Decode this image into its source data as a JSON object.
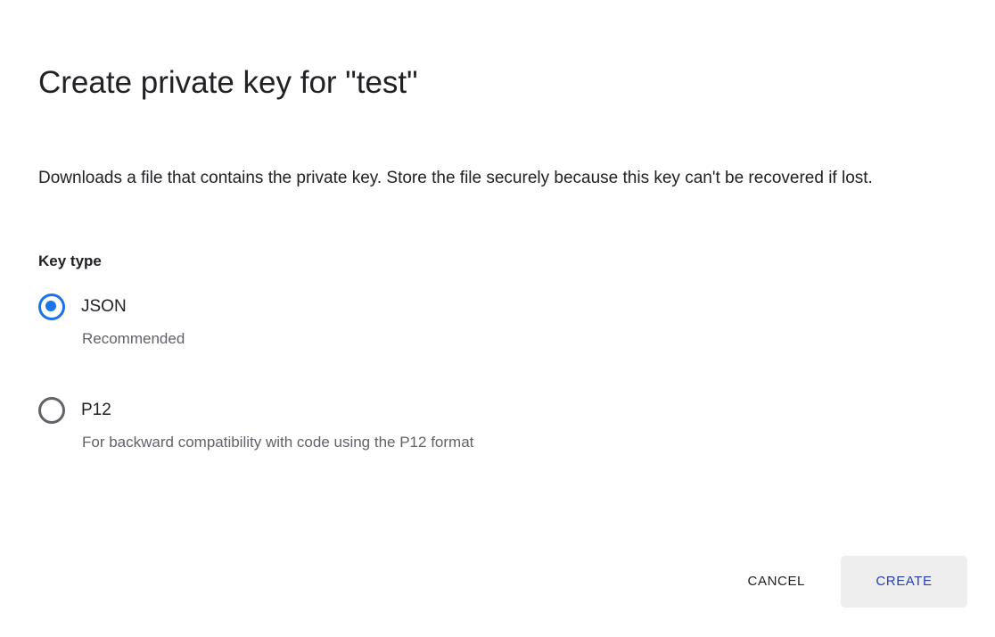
{
  "dialog": {
    "title": "Create private key for \"test\"",
    "description": "Downloads a file that contains the private key. Store the file securely because this key can't be recovered if lost.",
    "key_type": {
      "label": "Key type",
      "selected": "JSON",
      "options": [
        {
          "id": "json",
          "label": "JSON",
          "sublabel": "Recommended",
          "selected": true
        },
        {
          "id": "p12",
          "label": "P12",
          "sublabel": "For backward compatibility with code using the P12 format",
          "selected": false
        }
      ]
    },
    "actions": {
      "cancel_label": "CANCEL",
      "create_label": "CREATE"
    },
    "colors": {
      "accent": "#1a73e8",
      "create_text": "#2440b3",
      "create_background": "#eeeeee",
      "text_primary": "#202124",
      "text_secondary": "#5f6368",
      "surface": "#ffffff"
    }
  }
}
